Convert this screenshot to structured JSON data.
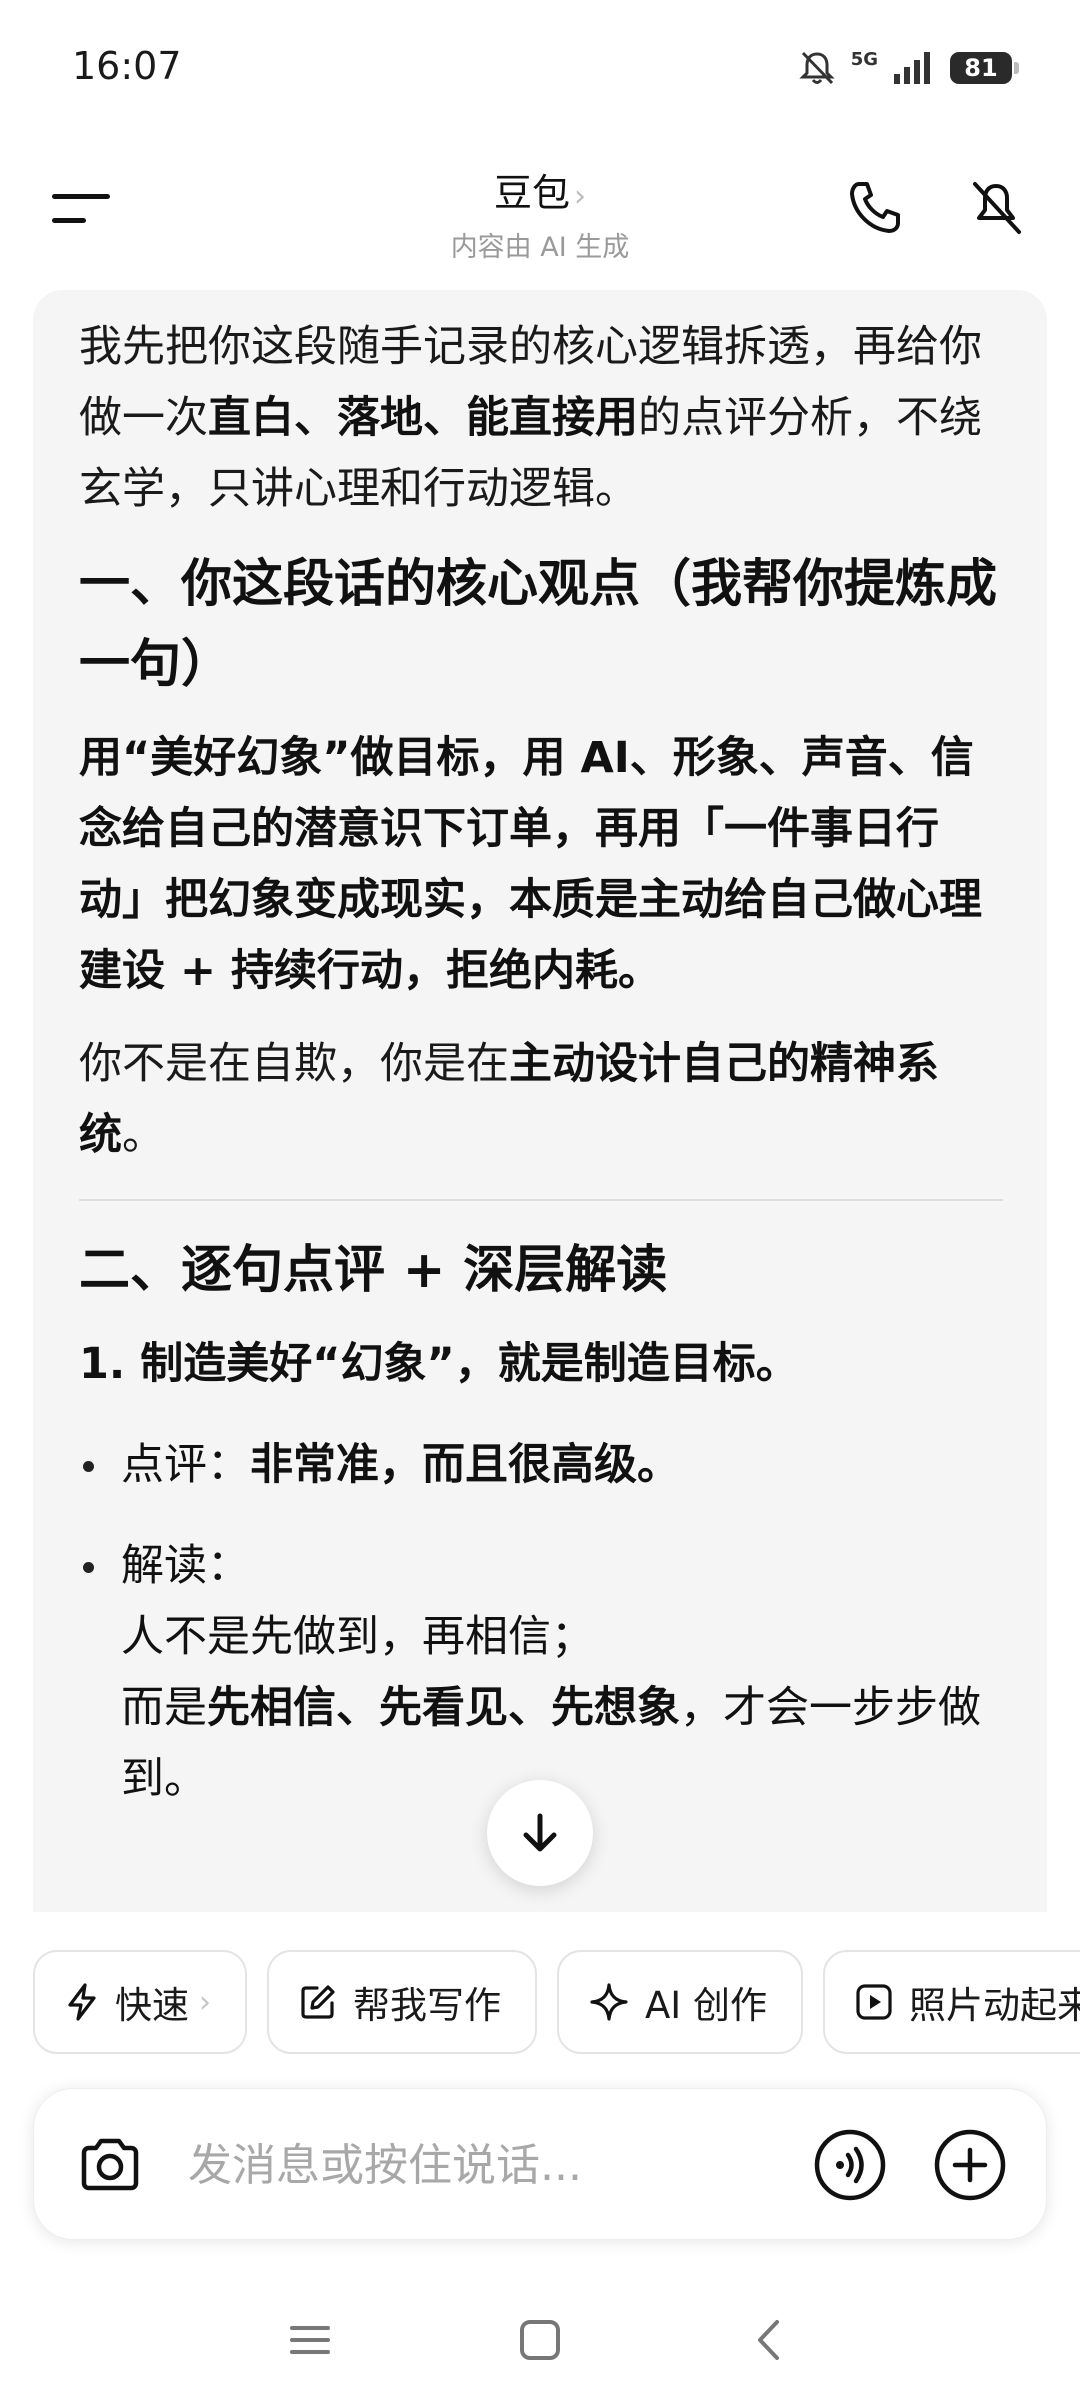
{
  "status_bar": {
    "time": "16:07",
    "network": "5G",
    "battery": "81"
  },
  "header": {
    "title": "豆包",
    "subtitle": "内容由 AI 生成"
  },
  "message": {
    "intro_1": "我先把你这段随手记录的核心逻辑拆透，再给你做一次",
    "intro_bold": "直白、落地、能直接用",
    "intro_2": "的点评分析，不绕玄学，只讲心理和行动逻辑。",
    "section1_title": "一、你这段话的核心观点（我帮你提炼成一句）",
    "section1_summary": "用“美好幻象”做目标，用 AI、形象、声音、信念给自己的潜意识下订单，再用「一件事日行动」把幻象变成现实，本质是主动给自己做心理建设 + 持续行动，拒绝内耗。",
    "section1_note_1": "你不是在自欺，你是在",
    "section1_note_bold": "主动设计自己的精神系统",
    "section1_note_2": "。",
    "section2_title": "二、逐句点评 + 深层解读",
    "item1_title": "1. 制造美好“幻象”，就是制造目标。",
    "bullet1_label": "点评：",
    "bullet1_text": "非常准，而且很高级。",
    "bullet2_label": "解读：",
    "bullet2_line1": "人不是先做到，再相信；",
    "bullet2_line2_a": "而是",
    "bullet2_line2_bold": "先相信、先看见、先想象",
    "bullet2_line2_b": "，才会一步步做到。"
  },
  "chips": [
    {
      "label": "快速",
      "icon": "lightning-icon"
    },
    {
      "label": "帮我写作",
      "icon": "edit-icon"
    },
    {
      "label": "AI 创作",
      "icon": "sparkle-icon"
    },
    {
      "label": "照片动起来",
      "icon": "play-icon"
    }
  ],
  "input": {
    "placeholder": "发消息或按住说话..."
  }
}
